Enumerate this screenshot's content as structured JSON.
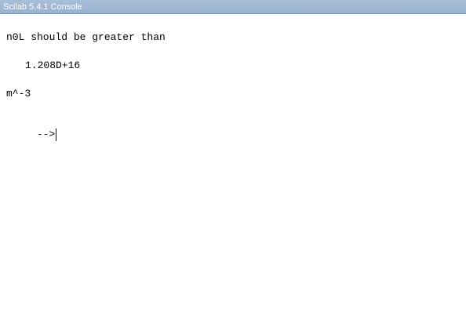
{
  "window": {
    "title": "Scilab 5.4.1 Console"
  },
  "console": {
    "lines": [
      "n0L should be greater than",
      "1.208D+16",
      "m^-3"
    ],
    "prompt": "-->"
  }
}
